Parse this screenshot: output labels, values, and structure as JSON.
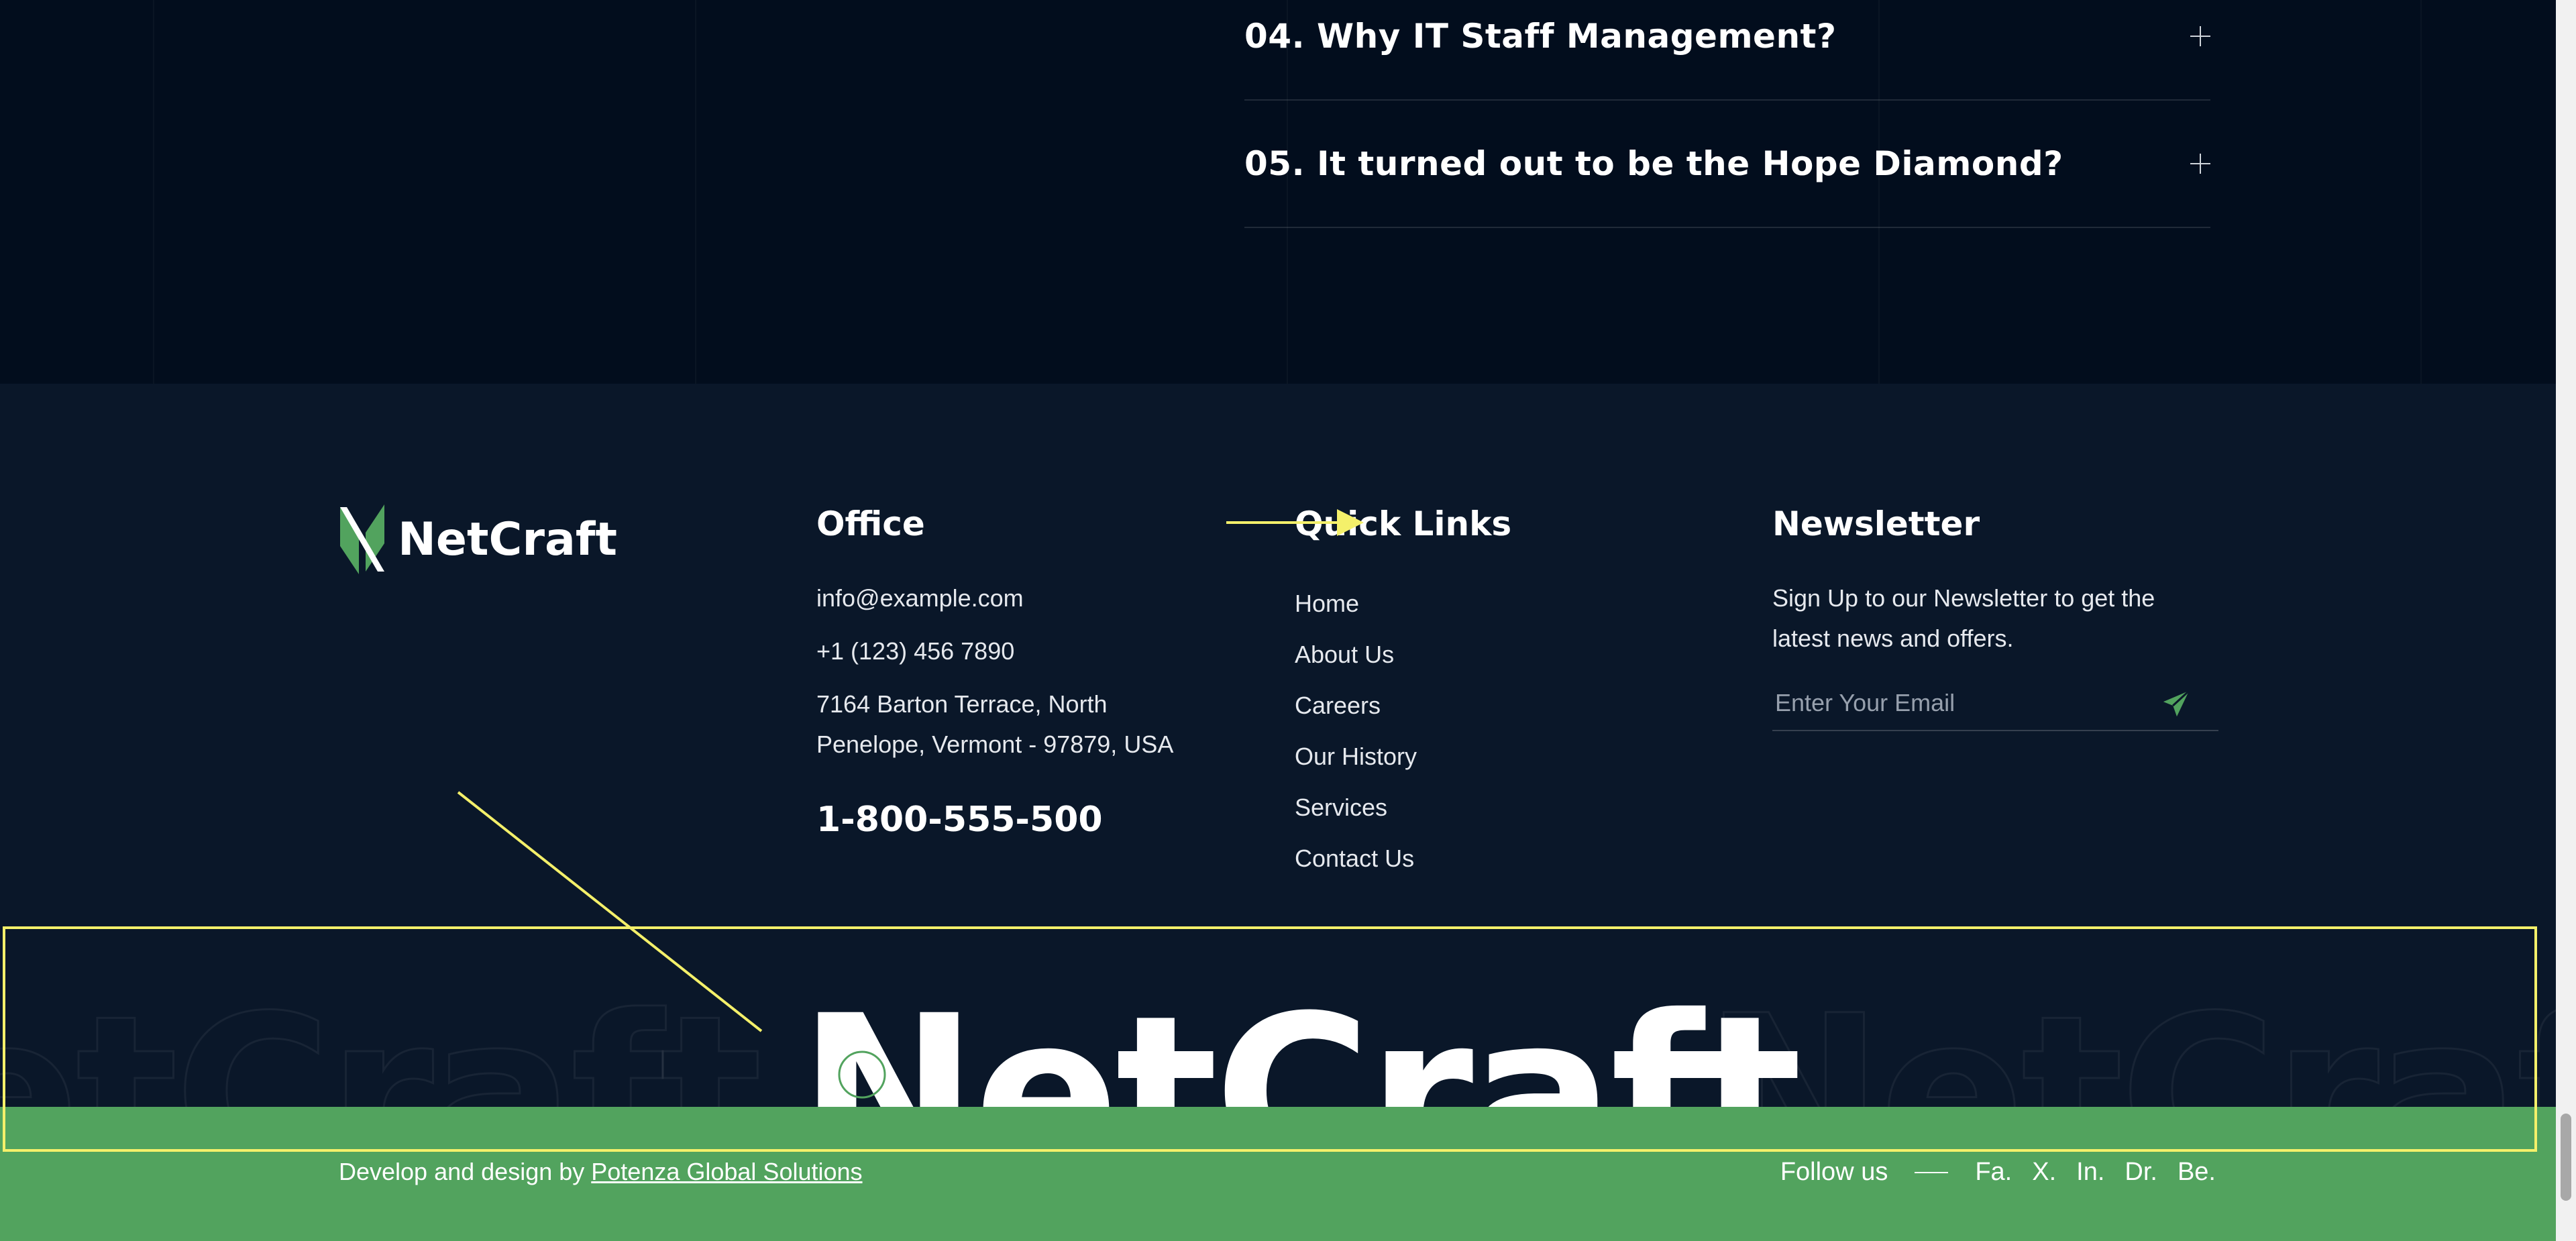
{
  "faq": {
    "items": [
      {
        "title": "04. Why IT Staff Management?"
      },
      {
        "title": "05. It turned out to be the Hope Diamond?"
      }
    ]
  },
  "footer": {
    "brand": "NetCraft",
    "office": {
      "title": "Office",
      "email": "info@example.com",
      "phone": "+1 (123) 456 7890",
      "address": "7164 Barton Terrace, North Penelope, Vermont - 97879, USA",
      "hotline": "1-800-555-500"
    },
    "quick_links": {
      "title": "Quick Links",
      "items": [
        "Home",
        "About Us",
        "Careers",
        "Our History",
        "Services",
        "Contact Us"
      ]
    },
    "newsletter": {
      "title": "Newsletter",
      "text": "Sign Up to our Newsletter to get the latest news and offers.",
      "placeholder": "Enter Your Email",
      "send_icon": "paper-plane-icon"
    },
    "watermark": "NetCraft"
  },
  "bottom_bar": {
    "credit_prefix": "Develop and design by ",
    "credit_link": "Potenza Global Solutions",
    "follow_label": "Follow us",
    "social": [
      "Fa.",
      "X.",
      "In.",
      "Dr.",
      "Be."
    ]
  },
  "colors": {
    "page_bg": "#020d1d",
    "footer_bg": "#0a1729",
    "accent_green": "#52a35e",
    "annotation_yellow": "#f4f06a"
  }
}
